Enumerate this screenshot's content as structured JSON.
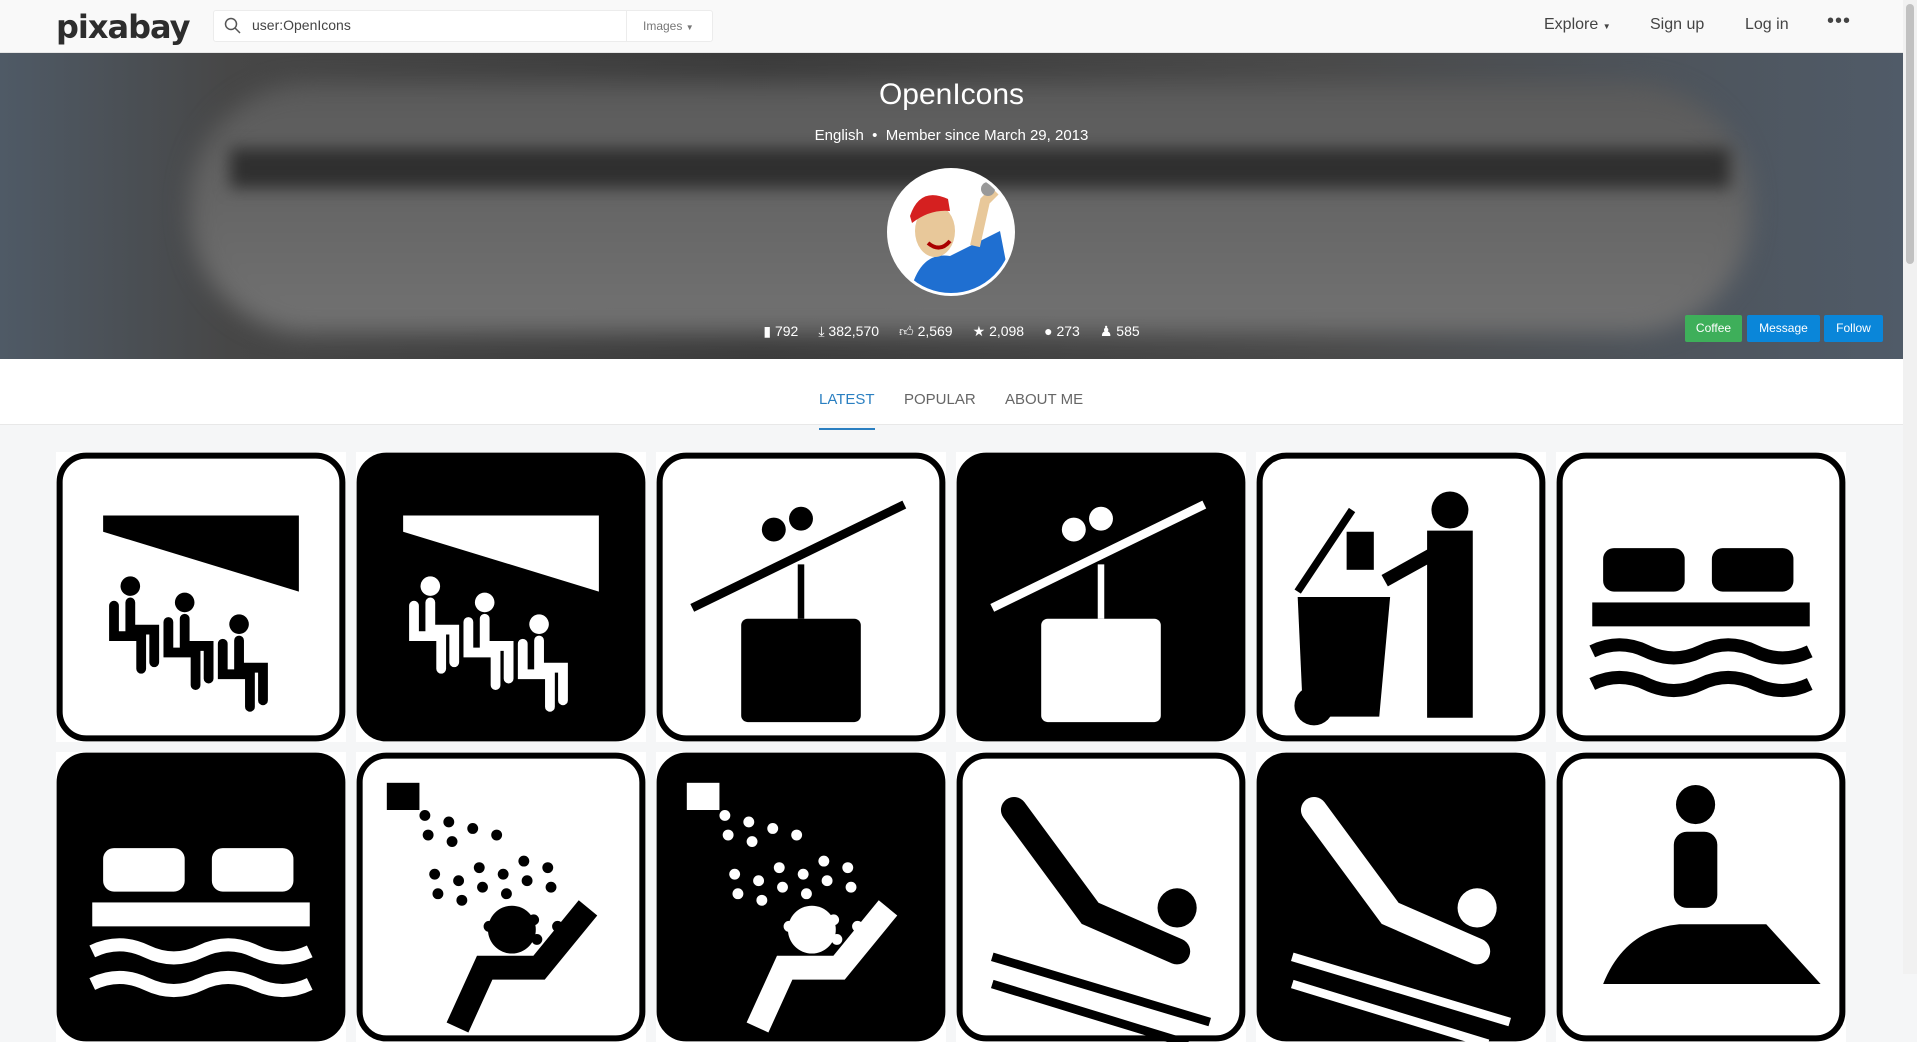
{
  "header": {
    "logo": "pixabay",
    "search_value": "user:OpenIcons",
    "search_type": "Images",
    "nav": {
      "explore": "Explore",
      "signup": "Sign up",
      "login": "Log in"
    }
  },
  "profile": {
    "name": "OpenIcons",
    "language": "English",
    "member_since": "Member since March 29, 2013",
    "stats": [
      {
        "icon": "images-icon",
        "value": "792"
      },
      {
        "icon": "download-icon",
        "value": "382,570"
      },
      {
        "icon": "thumbs-up-icon",
        "value": "2,569"
      },
      {
        "icon": "star-icon",
        "value": "2,098"
      },
      {
        "icon": "comment-icon",
        "value": "273"
      },
      {
        "icon": "followers-icon",
        "value": "585"
      }
    ],
    "buttons": {
      "coffee": "Coffee",
      "message": "Message",
      "follow": "Follow"
    },
    "colors": {
      "coffee": "#3eaf5a",
      "message": "#0a86d9",
      "follow": "#0a86d9"
    }
  },
  "tabs": [
    {
      "label": "LATEST",
      "active": true
    },
    {
      "label": "POPULAR"
    },
    {
      "label": "ABOUT ME"
    }
  ],
  "tiles": [
    {
      "icon": "theater-seating",
      "inverted": false
    },
    {
      "icon": "theater-seating",
      "inverted": true
    },
    {
      "icon": "aerial-tramway",
      "inverted": false
    },
    {
      "icon": "aerial-tramway",
      "inverted": true
    },
    {
      "icon": "trash-dumping",
      "inverted": false
    },
    {
      "icon": "car-ferry",
      "inverted": false
    },
    {
      "icon": "car-ferry",
      "inverted": true
    },
    {
      "icon": "shower",
      "inverted": false
    },
    {
      "icon": "shower",
      "inverted": true
    },
    {
      "icon": "water-slide",
      "inverted": false
    },
    {
      "icon": "water-slide",
      "inverted": true
    },
    {
      "icon": "jet-ski",
      "inverted": false
    }
  ]
}
